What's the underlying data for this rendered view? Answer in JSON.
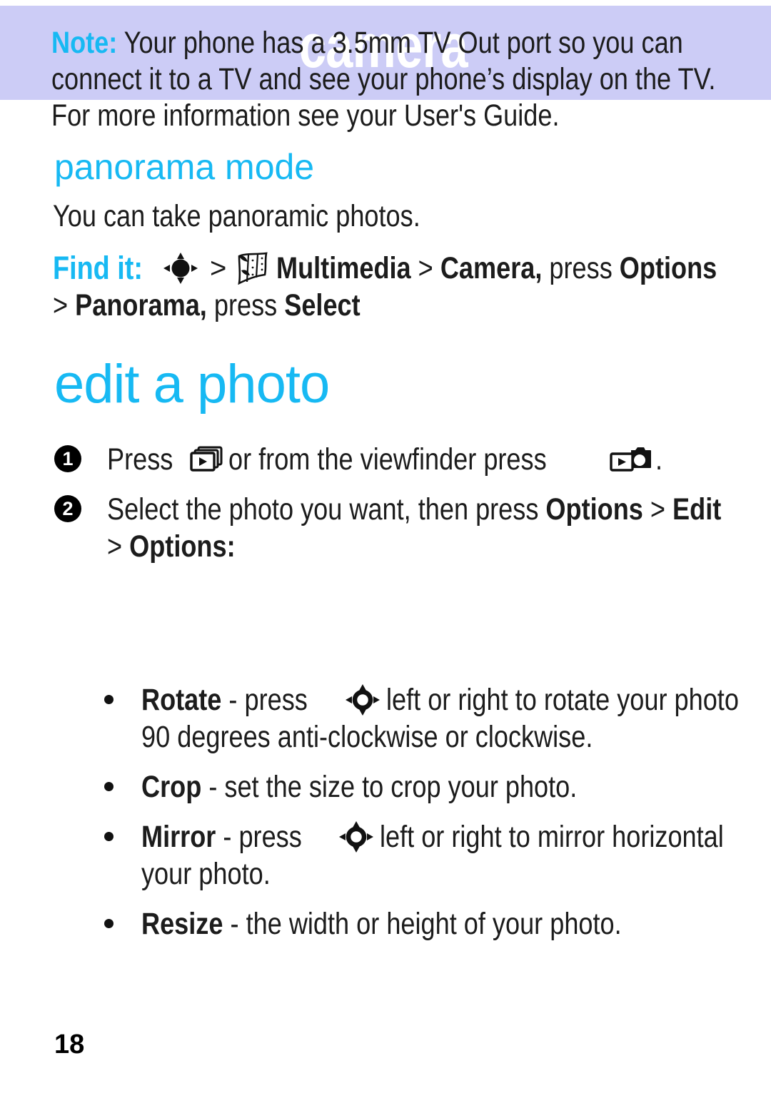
{
  "header": {
    "title": "camera",
    "band_color": "#ccccf6"
  },
  "colors": {
    "accent_cyan": "#17b9f3",
    "text": "#1c1c1c",
    "header_band": "#ccccf6"
  },
  "note": {
    "label": "Note:",
    "lines": [
      "Your phone has a 3.5mm TV Out port so you can",
      "connect it to a TV and see your phone’s display on the TV.",
      "For more information see your User's Guide."
    ]
  },
  "panorama_section": {
    "heading": "panorama mode",
    "description": "You can take panoramic photos.",
    "find_it": {
      "label": "Find it:",
      "line1": {
        "dpad_icon": "dpad-filled-icon",
        "sep1": ">",
        "multimedia_icon": "multimedia-filmstrip-icon",
        "multimedia": "Multimedia",
        "sep2": ">",
        "camera": "Camera,",
        "press": "press",
        "options": "Options"
      },
      "line2": {
        "sep": ">",
        "panorama": "Panorama,",
        "press": "press",
        "select": "Select"
      }
    }
  },
  "edit_section": {
    "heading": "edit a photo",
    "steps": [
      {
        "number": "1",
        "pre": "Press",
        "gallery_icon": "media-gallery-icon",
        "mid": "or from the viewfinder press",
        "camera_gallery_icon": "camera-gallery-icon",
        "post": "."
      },
      {
        "number": "2",
        "line1_pre": "Select the photo you want, then press",
        "line1_options": "Options",
        "line1_sep": ">",
        "line1_edit": "Edit",
        "line2_sep": ">",
        "line2_options": "Options:"
      }
    ],
    "bullets": [
      {
        "term": "Rotate",
        "dash": "-",
        "pre": "press",
        "dpad_icon": "dpad-ring-icon",
        "post": "left or right to rotate your photo",
        "line2": "90 degrees anti-clockwise or clockwise."
      },
      {
        "term": "Crop",
        "dash": "-",
        "pre": "set the size to crop your photo.",
        "dpad_icon": "",
        "post": "",
        "line2": ""
      },
      {
        "term": "Mirror",
        "dash": "-",
        "pre": "press",
        "dpad_icon": "dpad-ring-icon",
        "post": "left or right to mirror horizontal",
        "line2": "your photo."
      },
      {
        "term": "Resize",
        "dash": "-",
        "pre": "the width or height of your photo.",
        "dpad_icon": "",
        "post": "",
        "line2": ""
      }
    ]
  },
  "footer": {
    "page_number": "18"
  }
}
